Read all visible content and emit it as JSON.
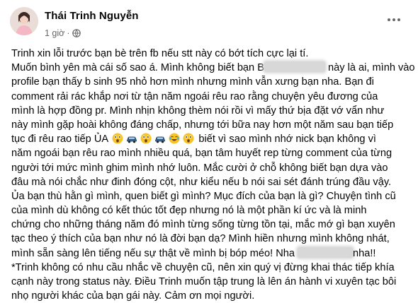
{
  "post": {
    "author": "Thái Trinh Nguyễn",
    "time": "1 giờ",
    "separator": "·",
    "privacy_icon": "globe-icon",
    "more_icon": "more-horizontal-icon"
  },
  "text": {
    "l1": "Trinh xin lỗi trước bạn bè trên fb nếu stt này có bớt tích cực lại tí.",
    "l2a": "Muốn bình yên mà cái số sao á. Mình không biết bạn B",
    "l2b": " này là ai, mình vào",
    "l3": "profile bạn thấy b sinh 95 nhỏ hơn mình nhưng mình vẫn xưng bạn nha. Bạn đi",
    "l4": "comment rải rác khắp nơi từ tận năm ngoái rêu rao rằng chuyện yêu đương của",
    "l5": "mình là hợp đồng pr. Mình nhịn không thèm nói rồi vì mấy thứ bịa đặt vớ vẩn như",
    "l6": "này mình gặp hoài không đáng chấp, nhưng tới bữa nay hơn một năm sau bạn tiếp",
    "l7a": "tục đi rêu rao tiếp ỦA",
    "l7b": "biết vì sao mình nhớ nick bạn không vì",
    "l8": "năm ngoái bạn rêu rao mình nhiều quá, bạn tâm huyết rep từng comment của từng",
    "l9": "người tới mức mình ghim mình nhớ luôn. Mắc cười ở chỗ không biết bạn dựa vào",
    "l10": "đâu mà nói chắc như đinh đóng cột, như kiểu nếu b nói sai sét đánh trúng đầu vậy.",
    "l11": "Ủa bạn thù hằn gì mình, quen biết gì mình? Mục đích của bạn là gì? Chuyện tình cũ",
    "l12": "của mình dù không có kết thúc tốt đẹp nhưng nó là một phần kí ức và là minh",
    "l13": "chứng cho những tháng năm đó mình từng sống từng tồn tại, mắc mớ gì bạn xuyên",
    "l14": "tạc theo ý thích của bạn như nó là đời bạn dạ? Mình hiền nhưng mình không nhát,",
    "l15a": "mình sẵn sàng lên tiếng nếu sự thật về mình bị bóp méo! Nha",
    "l15b": "nha!!",
    "l16": "*Trinh không có nhu cầu nhắc về chuyện cũ, nên xin quý vị đừng khai thác tiếp khía",
    "l17": "cạnh này trong status này. Điều Trinh muốn tập trung là lên án hành vi xuyên tạc bôi",
    "l18": "nhọ người khác của bạn gái này. Cảm ơn mọi người."
  },
  "emojis": [
    "astonished-emoji-icon",
    "car-emoji-icon",
    "astonished-emoji-icon",
    "car-emoji-icon",
    "joy-emoji-icon",
    "astonished-emoji-icon"
  ],
  "colors": {
    "text": "#050505",
    "secondary": "#65676b",
    "redaction": "#d8d8d8"
  }
}
